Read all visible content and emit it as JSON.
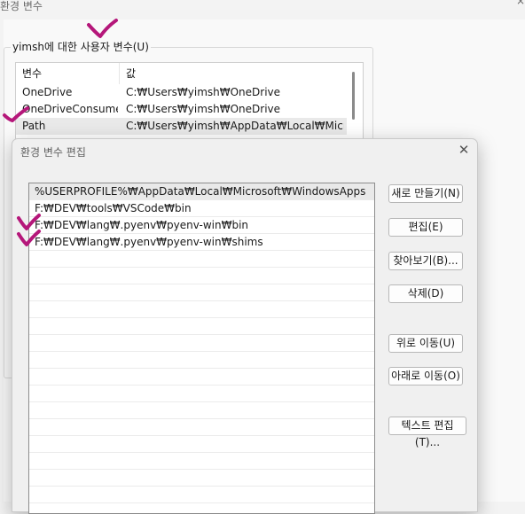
{
  "background_window": {
    "title": "환경 변수",
    "close_glyph": "×",
    "user_vars_group_label": "yimsh에 대한 사용자 변수(U)",
    "columns": {
      "name": "변수",
      "value": "값"
    },
    "rows": [
      {
        "name": "OneDrive",
        "value": "C:₩Users₩yimsh₩OneDrive"
      },
      {
        "name": "OneDriveConsumer",
        "value": "C:₩Users₩yimsh₩OneDrive"
      },
      {
        "name": "Path",
        "value": "C:₩Users₩yimsh₩AppData₩Local₩Microso..."
      }
    ],
    "selected_row": "Path"
  },
  "dialog": {
    "title": "환경 변수 편집",
    "close_glyph": "✕",
    "paths": [
      "%USERPROFILE%₩AppData₩Local₩Microsoft₩WindowsApps",
      "F:₩DEV₩tools₩VSCode₩bin",
      "F:₩DEV₩lang₩.pyenv₩pyenv-win₩bin",
      "F:₩DEV₩lang₩.pyenv₩pyenv-win₩shims"
    ],
    "buttons": {
      "new": "새로 만들기(N)",
      "edit": "편집(E)",
      "browse": "찾아보기(B)...",
      "delete": "삭제(D)",
      "move_up": "위로 이동(U)",
      "move_down": "아래로 이동(O)",
      "edit_text": "텍스트 편집(T)..."
    }
  },
  "annotation_color": "#b5177a"
}
